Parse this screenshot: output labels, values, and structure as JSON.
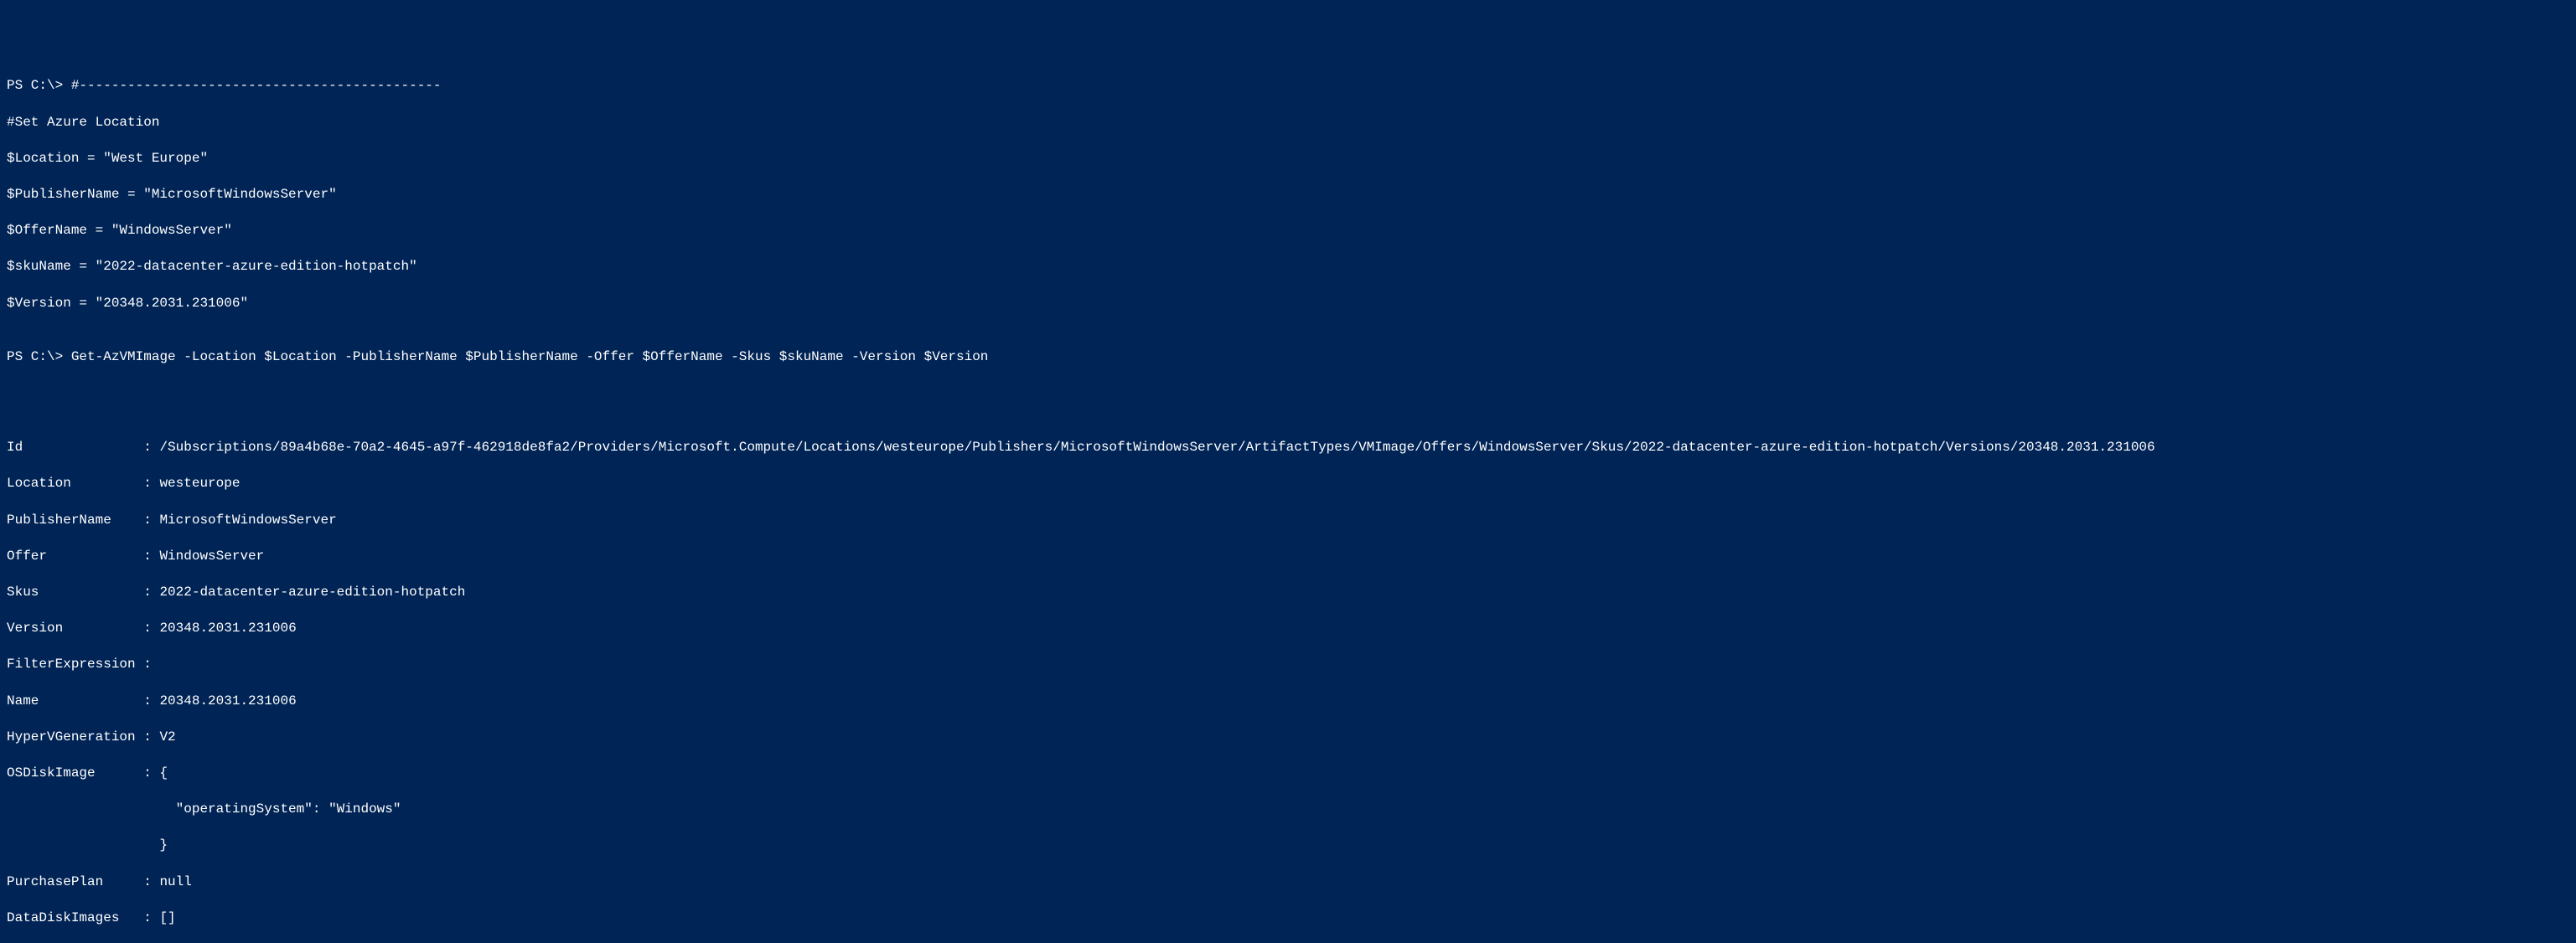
{
  "terminal": {
    "prompt1": "PS C:\\>",
    "dashline": "#---------------------------------------------",
    "comment1": "#Set Azure Location",
    "var_location": "$Location = \"West Europe\"",
    "var_publisher": "$PublisherName = \"MicrosoftWindowsServer\"",
    "var_offer": "$OfferName = \"WindowsServer\"",
    "var_sku": "$skuName = \"2022-datacenter-azure-edition-hotpatch\"",
    "var_version": "$Version = \"20348.2031.231006\"",
    "blank": "",
    "prompt2": "PS C:\\>",
    "command": "Get-AzVMImage -Location $Location -PublisherName $PublisherName -Offer $OfferName -Skus $skuName -Version $Version"
  },
  "output": {
    "id_label": "Id               : ",
    "id_value": "/Subscriptions/89a4b68e-70a2-4645-a97f-462918de8fa2/Providers/Microsoft.Compute/Locations/westeurope/Publishers/MicrosoftWindowsServer/ArtifactTypes/VMImage/Offers/WindowsServer/Skus/2022-datacenter-azure-edition-hotpatch/Versions/20348.2031.231006",
    "location_label": "Location         : ",
    "location_value": "westeurope",
    "publisher_label": "PublisherName    : ",
    "publisher_value": "MicrosoftWindowsServer",
    "offer_label": "Offer            : ",
    "offer_value": "WindowsServer",
    "skus_label": "Skus             : ",
    "skus_value": "2022-datacenter-azure-edition-hotpatch",
    "version_label": "Version          : ",
    "version_value": "20348.2031.231006",
    "filter_label": "FilterExpression :",
    "name_label": "Name             : ",
    "name_value": "20348.2031.231006",
    "hyperv_label": "HyperVGeneration : ",
    "hyperv_value": "V2",
    "osdisk_label": "OSDiskImage      : ",
    "osdisk_l1": "{",
    "osdisk_l2": "                     \"operatingSystem\": \"Windows\"",
    "osdisk_l3": "                   }",
    "purchase_label": "PurchasePlan     : ",
    "purchase_value": "null",
    "datadisk_label": "DataDiskImages   : ",
    "datadisk_value": "[]"
  }
}
